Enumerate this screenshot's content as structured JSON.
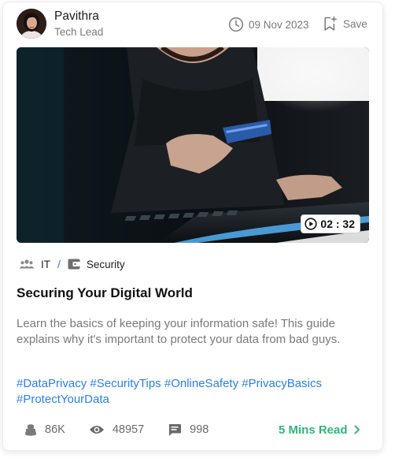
{
  "author": {
    "name": "Pavithra",
    "role": "Tech Lead"
  },
  "meta": {
    "date": "09 Nov 2023",
    "save_label": "Save"
  },
  "media": {
    "duration": "02 : 32"
  },
  "breadcrumb": {
    "category": "IT",
    "separator": "/",
    "subcategory": "Security"
  },
  "article": {
    "title": "Securing Your Digital World",
    "description": "Learn the basics of keeping your information safe! This guide explains why it's important to protect your data from bad guys.",
    "tags": [
      "#DataPrivacy",
      "#SecurityTips",
      "#OnlineSafety",
      "#PrivacyBasics",
      "#ProtectYourData"
    ]
  },
  "stats": {
    "likes": "86K",
    "views": "48957",
    "comments": "998"
  },
  "read_more": "5 Mins Read",
  "colors": {
    "accent": "#2a7ff0",
    "read_more": "#2fb67a",
    "muted": "#7a7a7a"
  },
  "icons": {
    "date": "clock-icon",
    "save": "bookmark-plus-icon",
    "play": "play-circle-icon",
    "category": "group-icon",
    "subcategory": "wallet-icon",
    "likes": "coin-stack-icon",
    "views": "eye-icon",
    "comments": "comment-icon",
    "read_more": "chevron-right-icon"
  }
}
